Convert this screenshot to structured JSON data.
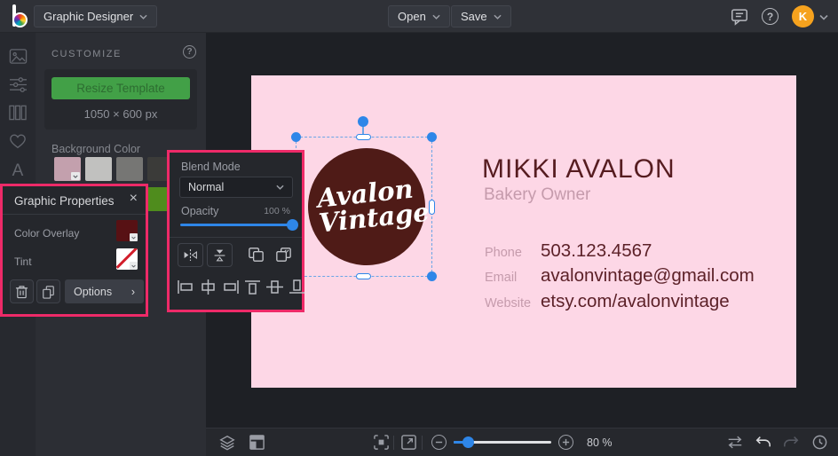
{
  "topbar": {
    "app_menu": "Graphic Designer",
    "open": "Open",
    "save": "Save",
    "avatar_initial": "K"
  },
  "icons": {
    "help_glyph": "?",
    "close_glyph": "×",
    "options_chevron": "›",
    "text_tool_glyph": "A"
  },
  "left_panel": {
    "title": "CUSTOMIZE",
    "resize_button": "Resize Template",
    "dimensions": "1050 × 600 px",
    "background_color_label": "Background Color",
    "swatches": [
      "#c3a0ad",
      "#c1c1bf",
      "#767674",
      "#3b3b39"
    ],
    "swatch_green": "#4f8c1d"
  },
  "graphic_properties": {
    "title": "Graphic Properties",
    "color_overlay_label": "Color Overlay",
    "color_overlay_value": "#571114",
    "tint_label": "Tint",
    "options_button": "Options"
  },
  "blend_panel": {
    "blend_mode_label": "Blend Mode",
    "blend_mode_value": "Normal",
    "opacity_label": "Opacity",
    "opacity_value": "100 %"
  },
  "canvas": {
    "card_color": "#fdd7e6",
    "logo_circle_color": "#4f1b17",
    "logo_line1": "Avalon",
    "logo_line2": "Vintage",
    "name": "MIKKI AVALON",
    "role": "Bakery Owner",
    "contacts": [
      {
        "label": "Phone",
        "value": "503.123.4567"
      },
      {
        "label": "Email",
        "value": "avalonvintage@gmail.com"
      },
      {
        "label": "Website",
        "value": "etsy.com/avalonvintage"
      }
    ]
  },
  "bottom_bar": {
    "zoom_level": "80 %"
  },
  "colors": {
    "accent_pink": "#ee2a68",
    "accent_blue": "#2e86e8",
    "accent_green": "#42a047",
    "avatar_orange": "#f6a21e"
  }
}
